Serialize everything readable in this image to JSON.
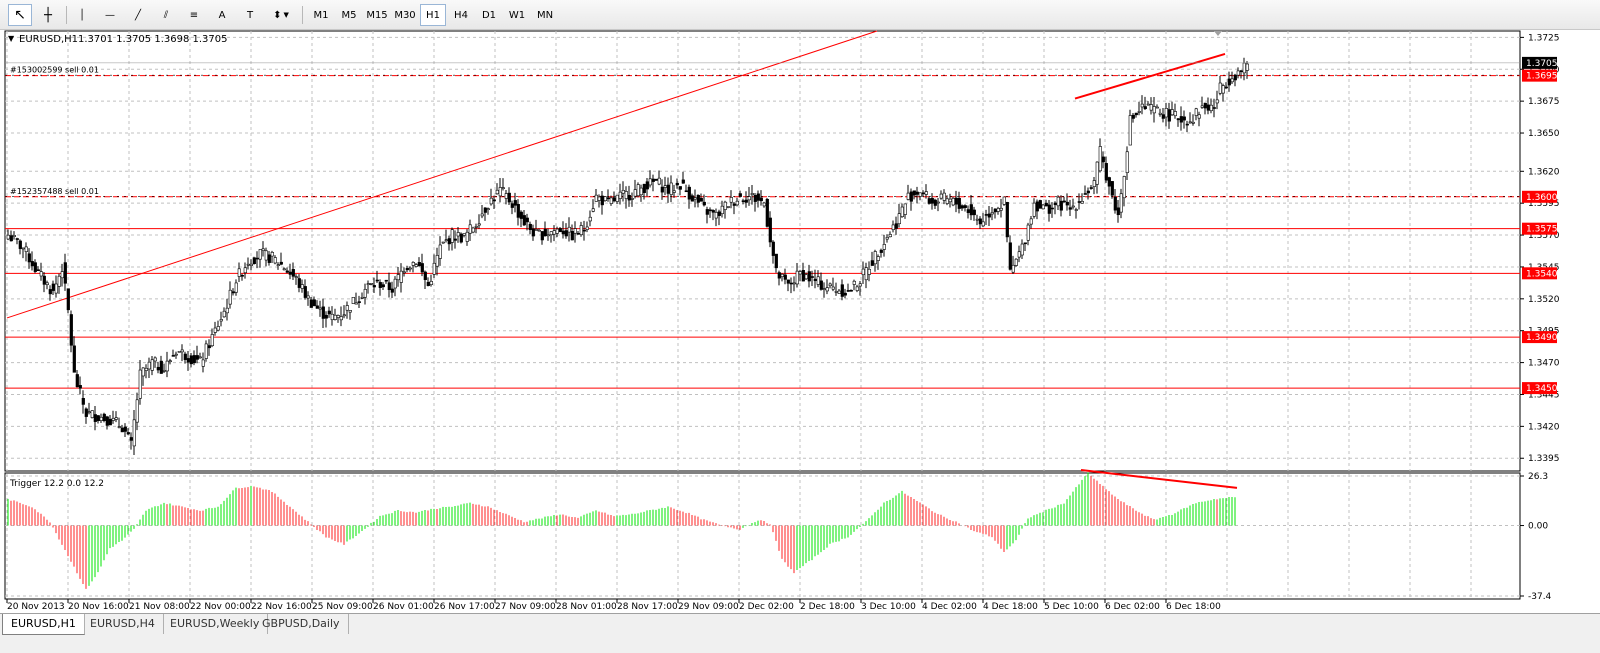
{
  "toolbar": {
    "timeframes": [
      "M1",
      "M5",
      "M15",
      "M30",
      "H1",
      "H4",
      "D1",
      "W1",
      "MN"
    ],
    "active_timeframe": "H1",
    "tools": [
      {
        "name": "cursor-icon",
        "glyph": "↖"
      },
      {
        "name": "crosshair-icon",
        "glyph": "┼"
      },
      {
        "name": "vertical-line-icon",
        "glyph": "│"
      },
      {
        "name": "horizontal-line-icon",
        "glyph": "—"
      },
      {
        "name": "trendline-icon",
        "glyph": "╱"
      },
      {
        "name": "equidistant-channel-icon",
        "glyph": "⫽"
      },
      {
        "name": "fibonacci-icon",
        "glyph": "≡"
      },
      {
        "name": "text-icon",
        "glyph": "A"
      },
      {
        "name": "text-label-icon",
        "glyph": "T"
      },
      {
        "name": "arrows-icon",
        "glyph": "⬍"
      }
    ]
  },
  "chart_header": {
    "symbol": "EURUSD,H1",
    "ohlc": "1.3701 1.3705 1.3698 1.3705"
  },
  "chart_data": [
    {
      "type": "candlestick",
      "symbol": "EURUSD,H1",
      "ylim": [
        1.3385,
        1.373
      ],
      "y_ticks": [
        "1.3725",
        "1.3700",
        "1.3675",
        "1.3650",
        "1.3620",
        "1.3595",
        "1.3570",
        "1.3545",
        "1.3520",
        "1.3495",
        "1.3470",
        "1.3445",
        "1.3420",
        "1.3395"
      ],
      "x_ticks": [
        "20 Nov 2013",
        "20 Nov 16:00",
        "21 Nov 08:00",
        "22 Nov 00:00",
        "22 Nov 16:00",
        "25 Nov 09:00",
        "26 Nov 01:00",
        "26 Nov 17:00",
        "27 Nov 09:00",
        "28 Nov 01:00",
        "28 Nov 17:00",
        "29 Nov 09:00",
        "2 Dec 02:00",
        "2 Dec 18:00",
        "3 Dec 10:00",
        "4 Dec 02:00",
        "4 Dec 18:00",
        "5 Dec 10:00",
        "6 Dec 02:00",
        "6 Dec 18:00"
      ],
      "grid": true,
      "close_anchors": [
        [
          0,
          1.357
        ],
        [
          5,
          1.356
        ],
        [
          10,
          1.354
        ],
        [
          15,
          1.3525
        ],
        [
          18,
          1.3545
        ],
        [
          20,
          1.351
        ],
        [
          22,
          1.346
        ],
        [
          26,
          1.343
        ],
        [
          30,
          1.3428
        ],
        [
          34,
          1.3425
        ],
        [
          38,
          1.342
        ],
        [
          41,
          1.3405
        ],
        [
          44,
          1.346
        ],
        [
          48,
          1.347
        ],
        [
          52,
          1.3465
        ],
        [
          56,
          1.348
        ],
        [
          60,
          1.3475
        ],
        [
          64,
          1.347
        ],
        [
          68,
          1.349
        ],
        [
          72,
          1.351
        ],
        [
          76,
          1.3535
        ],
        [
          80,
          1.355
        ],
        [
          84,
          1.3555
        ],
        [
          88,
          1.3552
        ],
        [
          92,
          1.3545
        ],
        [
          96,
          1.3535
        ],
        [
          100,
          1.352
        ],
        [
          104,
          1.351
        ],
        [
          108,
          1.3505
        ],
        [
          112,
          1.351
        ],
        [
          116,
          1.352
        ],
        [
          120,
          1.353
        ],
        [
          124,
          1.3532
        ],
        [
          128,
          1.3528
        ],
        [
          132,
          1.3545
        ],
        [
          136,
          1.355
        ],
        [
          140,
          1.353
        ],
        [
          144,
          1.356
        ],
        [
          148,
          1.357
        ],
        [
          152,
          1.3568
        ],
        [
          156,
          1.358
        ],
        [
          160,
          1.3595
        ],
        [
          164,
          1.3605
        ],
        [
          168,
          1.3595
        ],
        [
          172,
          1.358
        ],
        [
          176,
          1.357
        ],
        [
          180,
          1.3572
        ],
        [
          184,
          1.3575
        ],
        [
          188,
          1.357
        ],
        [
          192,
          1.3575
        ],
        [
          196,
          1.36
        ],
        [
          200,
          1.3595
        ],
        [
          204,
          1.36
        ],
        [
          208,
          1.3603
        ],
        [
          212,
          1.3608
        ],
        [
          216,
          1.3612
        ],
        [
          220,
          1.3605
        ],
        [
          224,
          1.361
        ],
        [
          228,
          1.36
        ],
        [
          232,
          1.359
        ],
        [
          236,
          1.3585
        ],
        [
          240,
          1.3595
        ],
        [
          244,
          1.36
        ],
        [
          248,
          1.36
        ],
        [
          252,
          1.3595
        ],
        [
          256,
          1.354
        ],
        [
          260,
          1.353
        ],
        [
          264,
          1.354
        ],
        [
          268,
          1.3535
        ],
        [
          272,
          1.353
        ],
        [
          276,
          1.3528
        ],
        [
          280,
          1.3525
        ],
        [
          284,
          1.3535
        ],
        [
          288,
          1.355
        ],
        [
          292,
          1.3565
        ],
        [
          296,
          1.358
        ],
        [
          300,
          1.36
        ],
        [
          304,
          1.3605
        ],
        [
          308,
          1.3595
        ],
        [
          312,
          1.3598
        ],
        [
          316,
          1.3595
        ],
        [
          320,
          1.359
        ],
        [
          324,
          1.358
        ],
        [
          328,
          1.359
        ],
        [
          332,
          1.3595
        ],
        [
          334,
          1.354
        ],
        [
          338,
          1.356
        ],
        [
          342,
          1.3595
        ],
        [
          346,
          1.359
        ],
        [
          350,
          1.3595
        ],
        [
          354,
          1.359
        ],
        [
          358,
          1.36
        ],
        [
          362,
          1.361
        ],
        [
          364,
          1.3635
        ],
        [
          368,
          1.36
        ],
        [
          370,
          1.3585
        ],
        [
          372,
          1.362
        ],
        [
          374,
          1.366
        ],
        [
          378,
          1.367
        ],
        [
          382,
          1.3668
        ],
        [
          386,
          1.3665
        ],
        [
          390,
          1.3662
        ],
        [
          394,
          1.366
        ],
        [
          398,
          1.367
        ],
        [
          402,
          1.367
        ],
        [
          404,
          1.3685
        ],
        [
          408,
          1.3695
        ],
        [
          412,
          1.37
        ],
        [
          413,
          1.3705
        ]
      ],
      "horizontal_lines": [
        {
          "price": "1.3695",
          "label": "#153002599 sell 0.01"
        },
        {
          "price": "1.3600",
          "label": "#152357488 sell 0.01"
        },
        {
          "price": "1.3575",
          "label": ""
        },
        {
          "price": "1.3540",
          "label": ""
        },
        {
          "price": "1.3490",
          "label": ""
        },
        {
          "price": "1.3450",
          "label": ""
        }
      ],
      "current_price": "1.3705",
      "trendlines": [
        {
          "from": [
            0,
            1.3505
          ],
          "to": [
            290,
            1.373
          ]
        },
        {
          "from": [
            356,
            1.3677
          ],
          "to": [
            406,
            1.3712
          ]
        }
      ]
    },
    {
      "type": "histogram",
      "name": "Trigger",
      "header": "Trigger 12.2 0.0 12.2",
      "ylim": [
        -37.4,
        26.3
      ],
      "y_ticks": [
        "26.3",
        "0.00",
        "-37.4"
      ],
      "anchors": [
        [
          0,
          14
        ],
        [
          8,
          10
        ],
        [
          14,
          2
        ],
        [
          20,
          -16
        ],
        [
          26,
          -34
        ],
        [
          30,
          -25
        ],
        [
          34,
          -12
        ],
        [
          38,
          -8
        ],
        [
          42,
          -2
        ],
        [
          46,
          8
        ],
        [
          52,
          12
        ],
        [
          58,
          10
        ],
        [
          64,
          8
        ],
        [
          70,
          10
        ],
        [
          76,
          20
        ],
        [
          82,
          21
        ],
        [
          88,
          18
        ],
        [
          94,
          10
        ],
        [
          100,
          2
        ],
        [
          106,
          -6
        ],
        [
          112,
          -10
        ],
        [
          118,
          -3
        ],
        [
          124,
          5
        ],
        [
          130,
          8
        ],
        [
          136,
          7
        ],
        [
          142,
          9
        ],
        [
          148,
          10
        ],
        [
          154,
          12
        ],
        [
          160,
          10
        ],
        [
          166,
          6
        ],
        [
          172,
          2
        ],
        [
          178,
          4
        ],
        [
          184,
          6
        ],
        [
          190,
          4
        ],
        [
          196,
          8
        ],
        [
          202,
          5
        ],
        [
          208,
          6
        ],
        [
          214,
          8
        ],
        [
          220,
          10
        ],
        [
          226,
          7
        ],
        [
          232,
          3
        ],
        [
          238,
          0
        ],
        [
          244,
          -2
        ],
        [
          250,
          3
        ],
        [
          254,
          1
        ],
        [
          258,
          -18
        ],
        [
          262,
          -25
        ],
        [
          268,
          -18
        ],
        [
          274,
          -10
        ],
        [
          280,
          -6
        ],
        [
          286,
          2
        ],
        [
          292,
          12
        ],
        [
          298,
          18
        ],
        [
          304,
          12
        ],
        [
          310,
          6
        ],
        [
          316,
          2
        ],
        [
          322,
          -3
        ],
        [
          328,
          -6
        ],
        [
          332,
          -14
        ],
        [
          336,
          -8
        ],
        [
          340,
          4
        ],
        [
          346,
          8
        ],
        [
          352,
          12
        ],
        [
          356,
          20
        ],
        [
          360,
          28
        ],
        [
          364,
          22
        ],
        [
          370,
          14
        ],
        [
          376,
          8
        ],
        [
          382,
          3
        ],
        [
          388,
          6
        ],
        [
          396,
          12
        ],
        [
          402,
          14
        ],
        [
          408,
          15
        ]
      ],
      "trendlines": [
        {
          "from": [
            358,
            29.5
          ],
          "to": [
            410,
            20
          ]
        }
      ]
    }
  ],
  "tabs": [
    "EURUSD,H1",
    "EURUSD,H4",
    "EURUSD,Weekly",
    "GBPUSD,Daily"
  ],
  "active_tab": "EURUSD,H1",
  "colors": {
    "bull_candle": "#ffffff",
    "bear_candle": "#000000",
    "level_line": "#ff0000",
    "grid": "#c0c0c0",
    "hist_up": "#00e600",
    "hist_down": "#ff2020",
    "price_tag_bg": "#ff0000",
    "current_tag_bg": "#000000"
  }
}
